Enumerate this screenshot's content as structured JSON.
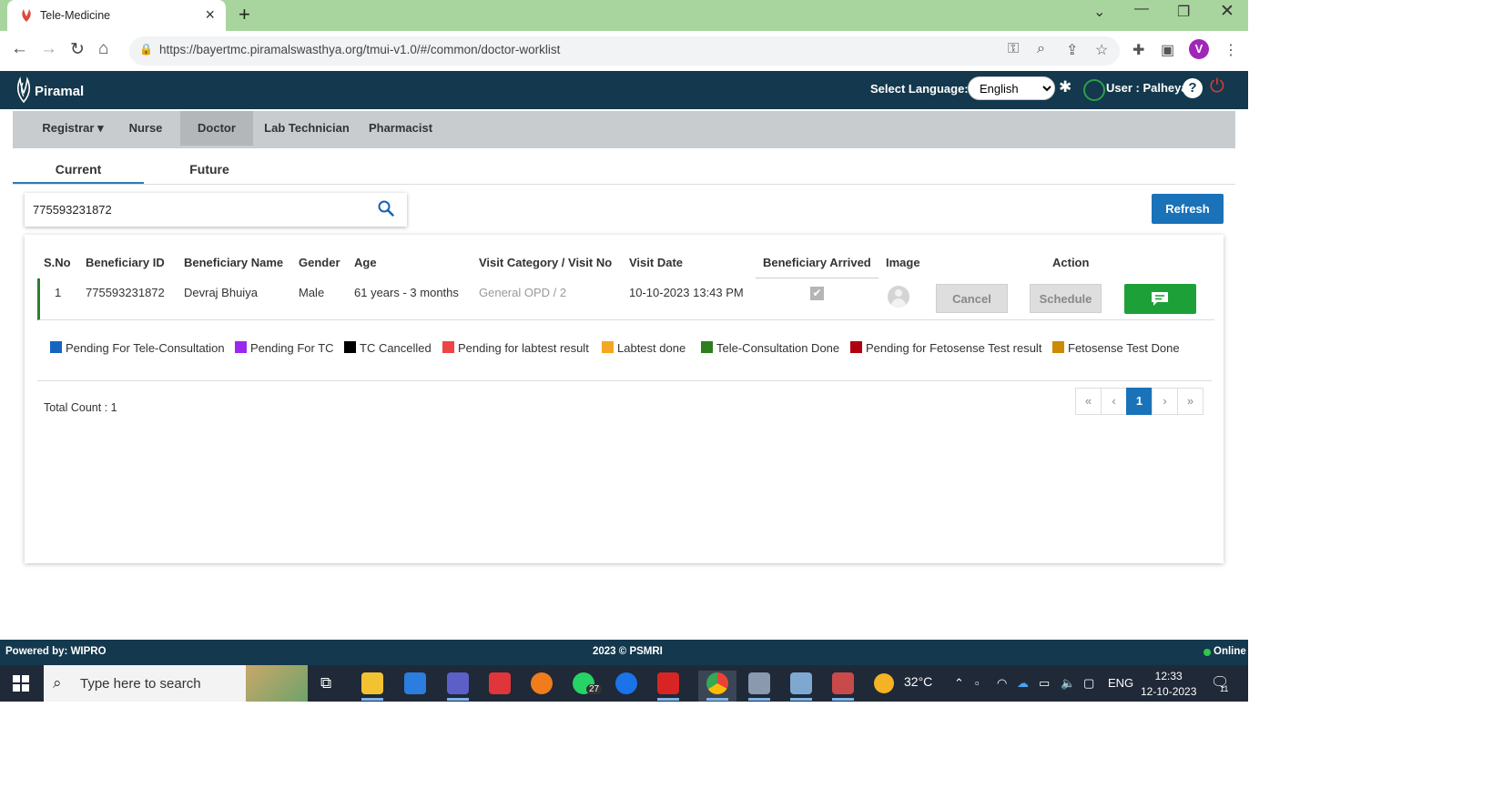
{
  "browser": {
    "tab_title": "Tele-Medicine",
    "url": "https://bayertmc.piramalswasthya.org/tmui-v1.0/#/common/doctor-worklist",
    "profile_initial": "V"
  },
  "header": {
    "brand": "Piramal",
    "select_language_label": "Select Language:",
    "language": "English",
    "user_label": "User : Palheya"
  },
  "roles": [
    {
      "label": "Registrar ▾"
    },
    {
      "label": "Nurse"
    },
    {
      "label": "Doctor"
    },
    {
      "label": "Lab Technician"
    },
    {
      "label": "Pharmacist"
    }
  ],
  "worklist_tabs": {
    "current": "Current",
    "future": "Future"
  },
  "search": {
    "value": "775593231872"
  },
  "refresh_label": "Refresh",
  "table": {
    "headers": [
      "S.No",
      "Beneficiary ID",
      "Beneficiary Name",
      "Gender",
      "Age",
      "Visit Category / Visit No",
      "Visit Date",
      "Beneficiary Arrived",
      "Image",
      "Action"
    ],
    "rows": [
      {
        "sno": "1",
        "beneficiary_id": "775593231872",
        "name": "Devraj Bhuiya",
        "gender": "Male",
        "age": "61 years - 3 months",
        "visit_category": "General OPD / 2",
        "visit_date": "10-10-2023 13:43 PM",
        "arrived": true,
        "cancel_label": "Cancel",
        "schedule_label": "Schedule"
      }
    ]
  },
  "legend": [
    {
      "label": "Pending For Tele-Consultation",
      "color": "#1565c0"
    },
    {
      "label": "Pending For TC",
      "color": "#9c27ef"
    },
    {
      "label": "TC Cancelled",
      "color": "#000000"
    },
    {
      "label": "Pending for labtest result",
      "color": "#ef4444"
    },
    {
      "label": "Labtest done",
      "color": "#f5a623"
    },
    {
      "label": "Tele-Consultation Done",
      "color": "#2e7d1e"
    },
    {
      "label": "Pending for Fetosense Test result",
      "color": "#b00010"
    },
    {
      "label": "Fetosense Test Done",
      "color": "#cc8a00"
    }
  ],
  "total_count": "Total Count : 1",
  "pagination": {
    "first": "«",
    "prev": "‹",
    "current": "1",
    "next": "›",
    "last": "»"
  },
  "footer": {
    "powered": "Powered by: WIPRO",
    "copyright": "2023 © PSMRI",
    "status": "Online"
  },
  "taskbar": {
    "search_placeholder": "Type here to search",
    "weather": "32°C",
    "whatsapp_badge": "27",
    "language": "ENG",
    "time": "12:33",
    "date": "12-10-2023",
    "notifications": "11"
  }
}
